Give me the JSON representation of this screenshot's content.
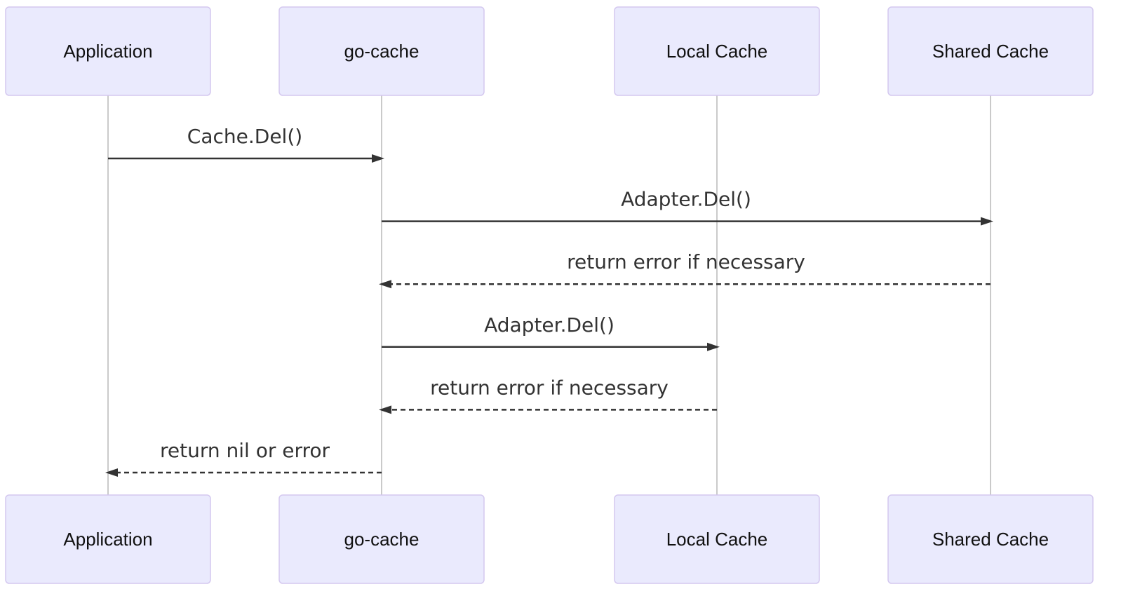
{
  "diagram": {
    "type": "sequence",
    "participants": [
      {
        "id": "app",
        "label": "Application"
      },
      {
        "id": "gocache",
        "label": "go-cache"
      },
      {
        "id": "local",
        "label": "Local Cache"
      },
      {
        "id": "shared",
        "label": "Shared Cache"
      }
    ],
    "messages": [
      {
        "from": "app",
        "to": "gocache",
        "label": "Cache.Del()",
        "style": "solid"
      },
      {
        "from": "gocache",
        "to": "shared",
        "label": "Adapter.Del()",
        "style": "solid"
      },
      {
        "from": "shared",
        "to": "gocache",
        "label": "return error if necessary",
        "style": "dashed"
      },
      {
        "from": "gocache",
        "to": "local",
        "label": "Adapter.Del()",
        "style": "solid"
      },
      {
        "from": "local",
        "to": "gocache",
        "label": "return error if necessary",
        "style": "dashed"
      },
      {
        "from": "gocache",
        "to": "app",
        "label": "return nil or error",
        "style": "dashed"
      }
    ],
    "colors": {
      "actor_fill": "#eaeafd",
      "actor_border": "#d4c8ef",
      "lifeline": "#b8b8b8",
      "message": "#333333"
    }
  }
}
